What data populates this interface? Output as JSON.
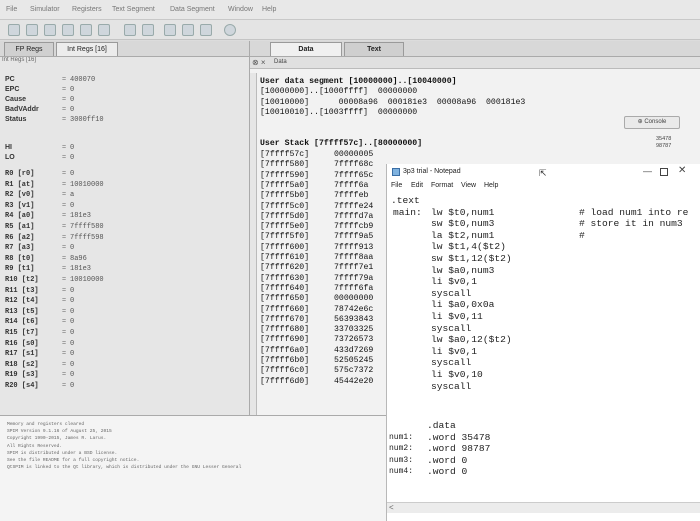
{
  "menubar": {
    "items": [
      "File",
      "Simulator",
      "Registers",
      "Text Segment",
      "Data Segment",
      "Window",
      "Help"
    ]
  },
  "registers": {
    "tabs": [
      "FP Regs",
      "Int Regs [16]"
    ],
    "sub_tab": "Int Regs [16]",
    "special": [
      {
        "name": "PC",
        "value": "400070"
      },
      {
        "name": "EPC",
        "value": "0"
      },
      {
        "name": "Cause",
        "value": "0"
      },
      {
        "name": "BadVAddr",
        "value": "0"
      },
      {
        "name": "Status",
        "value": "3000ff10"
      }
    ],
    "hilo": [
      {
        "name": "HI",
        "value": "0"
      },
      {
        "name": "LO",
        "value": "0"
      }
    ],
    "general": [
      {
        "name": "R0  [r0]",
        "value": "0"
      },
      {
        "name": "R1  [at]",
        "value": "10010000"
      },
      {
        "name": "R2  [v0]",
        "value": "a"
      },
      {
        "name": "R3  [v1]",
        "value": "0"
      },
      {
        "name": "R4  [a0]",
        "value": "181e3"
      },
      {
        "name": "R5  [a1]",
        "value": "7ffff580"
      },
      {
        "name": "R6  [a2]",
        "value": "7ffff598"
      },
      {
        "name": "R7  [a3]",
        "value": "0"
      },
      {
        "name": "R8  [t0]",
        "value": "8a96"
      },
      {
        "name": "R9  [t1]",
        "value": "181e3"
      },
      {
        "name": "R10 [t2]",
        "value": "10010000"
      },
      {
        "name": "R11 [t3]",
        "value": "0"
      },
      {
        "name": "R12 [t4]",
        "value": "0"
      },
      {
        "name": "R13 [t5]",
        "value": "0"
      },
      {
        "name": "R14 [t6]",
        "value": "0"
      },
      {
        "name": "R15 [t7]",
        "value": "0"
      },
      {
        "name": "R16 [s0]",
        "value": "0"
      },
      {
        "name": "R17 [s1]",
        "value": "0"
      },
      {
        "name": "R18 [s2]",
        "value": "0"
      },
      {
        "name": "R19 [s3]",
        "value": "0"
      },
      {
        "name": "R20 [s4]",
        "value": "0"
      }
    ]
  },
  "data_panel": {
    "tabs": [
      "Data",
      "Text"
    ],
    "sub_label": "Data",
    "user_data_header": "User data segment [10000000]..[10040000]",
    "user_data_lines": [
      "[10000000]..[1000ffff]  00000000",
      "[10010000]      00008a96  000181e3  00008a96  000181e3",
      "[10010010]..[1003ffff]  00000000"
    ],
    "user_stack_header": "User Stack [7ffff57c]..[80000000]",
    "stack_addrs": [
      "[7ffff57c]",
      "[7ffff580]",
      "[7ffff590]",
      "[7ffff5a0]",
      "[7ffff5b0]",
      "[7ffff5c0]",
      "[7ffff5d0]",
      "[7ffff5e0]",
      "[7ffff5f0]",
      "[7ffff600]",
      "[7ffff610]",
      "[7ffff620]",
      "[7ffff630]",
      "[7ffff640]",
      "[7ffff650]",
      "[7ffff660]",
      "[7ffff670]",
      "[7ffff680]",
      "[7ffff690]",
      "[7ffff6a0]",
      "[7ffff6b0]",
      "[7ffff6c0]",
      "[7ffff6d0]"
    ],
    "stack_vals": [
      "00000005",
      "7ffff68c",
      "7ffff65c",
      "7ffff6a",
      "7ffffeb",
      "7ffffe24",
      "7ffffd7a",
      "7ffffcb9",
      "7ffff9a5",
      "7ffff913",
      "7ffff8aa",
      "7ffff7e1",
      "7ffff79a",
      "7ffff6fa",
      "00000000",
      "78742e6c",
      "56393843",
      "33703325",
      "73726573",
      "433d7269",
      "52505245",
      "575c7372",
      "45442e20"
    ],
    "console_label": "Console",
    "mini_info": [
      "35478",
      "98787"
    ]
  },
  "notepad": {
    "title": "3p3 trial - Notepad",
    "menu": [
      "File",
      "Edit",
      "Format",
      "View",
      "Help"
    ],
    "lines": [
      {
        "label": "",
        "code": ".text",
        "comment": ""
      },
      {
        "label": "main:",
        "code": "lw $t0,num1",
        "comment": "# load num1 into re"
      },
      {
        "label": "",
        "code": "sw $t0,num3",
        "comment": "# store it in num3"
      },
      {
        "label": "",
        "code": "la $t2,num1",
        "comment": "#"
      },
      {
        "label": "",
        "code": "lw $t1,4($t2)",
        "comment": ""
      },
      {
        "label": "",
        "code": "sw $t1,12($t2)",
        "comment": ""
      },
      {
        "label": "",
        "code": "lw $a0,num3",
        "comment": ""
      },
      {
        "label": "",
        "code": "li $v0,1",
        "comment": ""
      },
      {
        "label": "",
        "code": "syscall",
        "comment": ""
      },
      {
        "label": "",
        "code": "li $a0,0x0a",
        "comment": ""
      },
      {
        "label": "",
        "code": "li $v0,11",
        "comment": ""
      },
      {
        "label": "",
        "code": "syscall",
        "comment": ""
      },
      {
        "label": "",
        "code": "lw $a0,12($t2)",
        "comment": ""
      },
      {
        "label": "",
        "code": "li $v0,1",
        "comment": ""
      },
      {
        "label": "",
        "code": "syscall",
        "comment": ""
      },
      {
        "label": "",
        "code": "li $v0,10",
        "comment": ""
      },
      {
        "label": "",
        "code": "syscall",
        "comment": ""
      }
    ],
    "data_lines": [
      {
        "label": "",
        "code": ".data"
      },
      {
        "label": "num1:",
        "code": ".word 35478"
      },
      {
        "label": "num2:",
        "code": ".word 98787"
      },
      {
        "label": "num3:",
        "code": ".word 0"
      },
      {
        "label": "num4:",
        "code": ".word 0"
      }
    ]
  },
  "messages": {
    "lines": [
      "Memory and registers cleared",
      "SPIM Version 9.1.16 of August 25, 2015",
      "Copyright 1990-2015, James R. Larus.",
      "All Rights Reserved.",
      "SPIM is distributed under a BSD license.",
      "See the file README for a full copyright notice.",
      "QtSPIM is linked to the Qt library, which is distributed under the GNU Lesser General"
    ]
  },
  "colors": {
    "panel_bg": "#e6e6e6",
    "notepad_bg": "#ffffff",
    "accent": "#3a6ea5"
  }
}
